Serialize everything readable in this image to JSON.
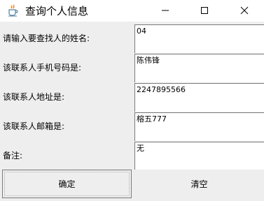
{
  "window": {
    "title": "查询个人信息",
    "app_icon": "java-cup-icon",
    "controls": {
      "minimize": "minimize-icon",
      "maximize": "maximize-icon",
      "close": "close-icon"
    }
  },
  "form": {
    "rows": [
      {
        "label": "请输入要查找人的姓名:",
        "value": "04"
      },
      {
        "label": "该联系人手机号码是:",
        "value": "陈伟锋"
      },
      {
        "label": "该联系人地址是:",
        "value": "2247895566"
      },
      {
        "label": "该联系人邮箱是:",
        "value": "榕五777"
      },
      {
        "label": "备注:",
        "value": "无"
      }
    ]
  },
  "buttons": {
    "ok": "确定",
    "clear": "清空"
  }
}
